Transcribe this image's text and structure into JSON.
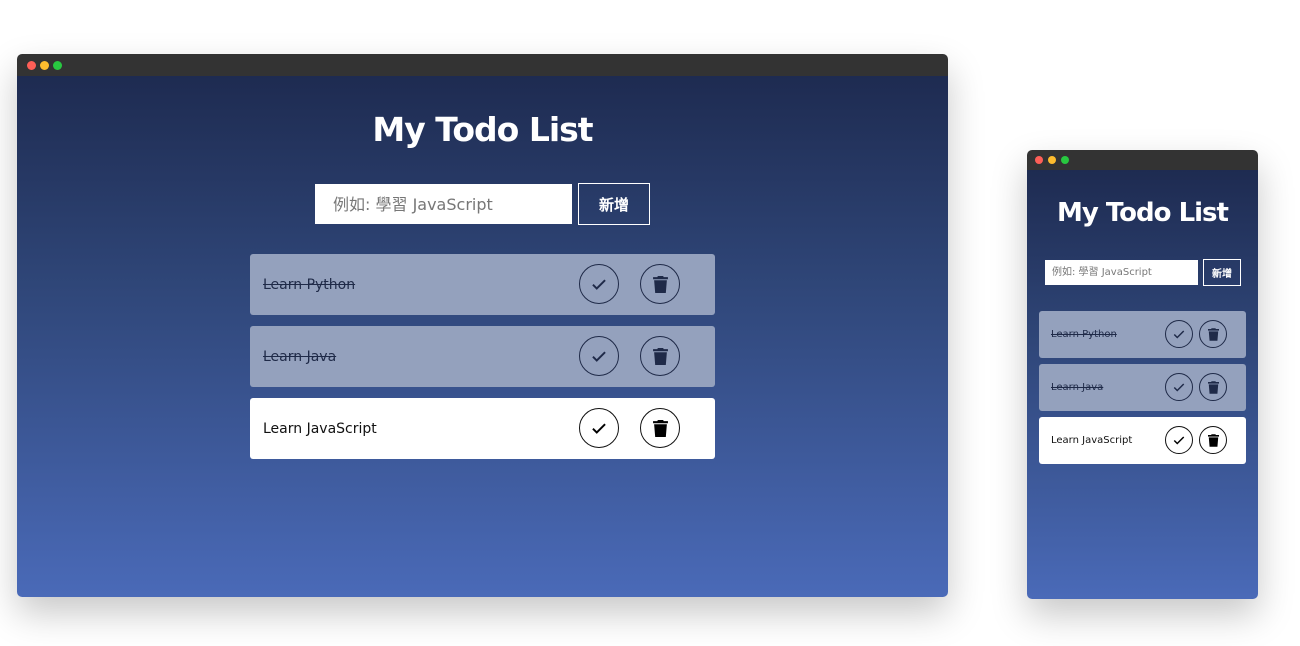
{
  "app": {
    "title": "My Todo List",
    "input_placeholder": "例如: 學習 JavaScript",
    "input_value": "",
    "add_label": "新增"
  },
  "todos": [
    {
      "text": "Learn Python",
      "completed": true
    },
    {
      "text": "Learn Java",
      "completed": true
    },
    {
      "text": "Learn JavaScript",
      "completed": false
    }
  ],
  "icons": {
    "complete": "check-icon",
    "delete": "trash-icon",
    "window_controls": [
      "close-dot",
      "minimize-dot",
      "maximize-dot"
    ]
  },
  "colors": {
    "titlebar": "#333333",
    "gradient_top": "#1e2b51",
    "gradient_bottom": "#4a6ab8",
    "completed_item": "#94a1bd",
    "active_item": "#ffffff",
    "close_dot": "#fe5f57",
    "minimize_dot": "#febc2e",
    "maximize_dot": "#28c840"
  }
}
